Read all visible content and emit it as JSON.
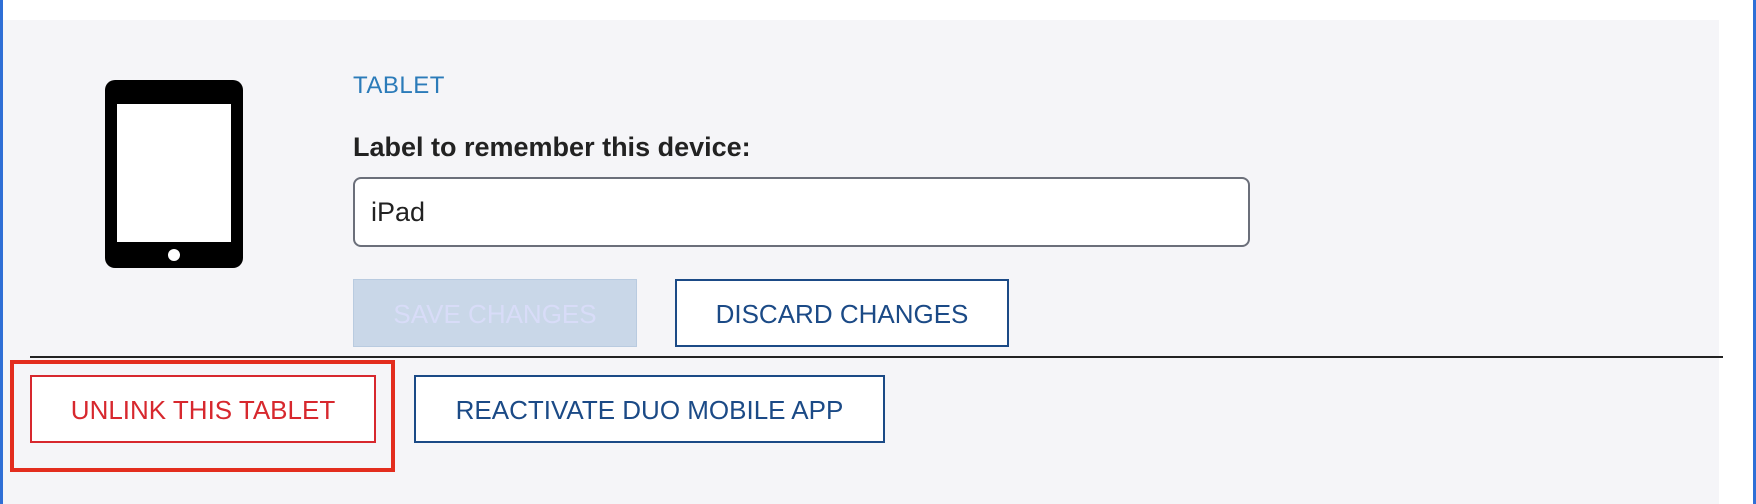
{
  "device": {
    "type_label": "TABLET",
    "icon": "tablet-icon"
  },
  "label_field": {
    "label": "Label to remember this device:",
    "value": "iPad"
  },
  "actions": {
    "save_label": "SAVE CHANGES",
    "discard_label": "DISCARD CHANGES",
    "unlink_label": "UNLINK THIS TABLET",
    "reactivate_label": "REACTIVATE DUO MOBILE APP"
  },
  "colors": {
    "panel_background": "#f5f5f8",
    "link_blue": "#2b7bb9",
    "primary_blue": "#1b4a86",
    "danger_red": "#d7282e",
    "highlight_red": "#e32d1e"
  }
}
